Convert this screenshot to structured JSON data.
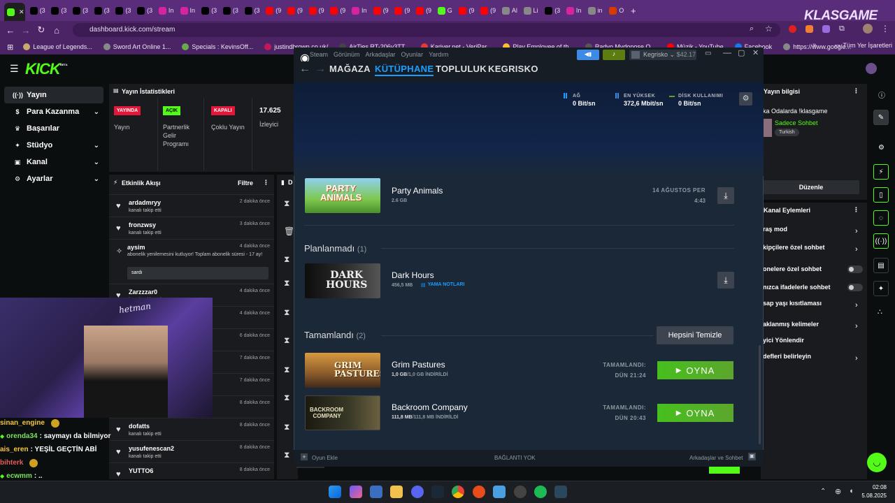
{
  "browser": {
    "tabs": [
      {
        "icon": "kick-icon",
        "label": "",
        "color": "#53fc18"
      },
      {
        "icon": "x-icon",
        "label": "(3",
        "color": "#000000"
      },
      {
        "icon": "x-icon",
        "label": "(3",
        "color": "#000000"
      },
      {
        "icon": "x-icon",
        "label": "(3",
        "color": "#000000"
      },
      {
        "icon": "x-icon",
        "label": "(3",
        "color": "#000000"
      },
      {
        "icon": "x-icon",
        "label": "(3",
        "color": "#000000"
      },
      {
        "icon": "x-icon",
        "label": "(3",
        "color": "#000000"
      },
      {
        "icon": "instagram-icon",
        "label": "In",
        "color": "#d6249f"
      },
      {
        "icon": "instagram-icon",
        "label": "In",
        "color": "#d6249f"
      },
      {
        "icon": "x-icon",
        "label": "(3",
        "color": "#000000"
      },
      {
        "icon": "x-icon",
        "label": "(3",
        "color": "#000000"
      },
      {
        "icon": "x-icon",
        "label": "(3",
        "color": "#000000"
      },
      {
        "icon": "youtube-icon",
        "label": "(9",
        "color": "#ff0000"
      },
      {
        "icon": "youtube-icon",
        "label": "(9",
        "color": "#ff0000"
      },
      {
        "icon": "youtube-icon",
        "label": "(9",
        "color": "#ff0000"
      },
      {
        "icon": "youtube-icon",
        "label": "(9",
        "color": "#ff0000"
      },
      {
        "icon": "instagram-icon",
        "label": "In",
        "color": "#d6249f"
      },
      {
        "icon": "youtube-icon",
        "label": "(9",
        "color": "#ff0000"
      },
      {
        "icon": "youtube-icon",
        "label": "(9",
        "color": "#ff0000"
      },
      {
        "icon": "youtube-icon",
        "label": "(9",
        "color": "#ff0000"
      },
      {
        "icon": "kick-icon",
        "label": "G",
        "color": "#53fc18"
      },
      {
        "icon": "youtube-icon",
        "label": "(9",
        "color": "#ff0000"
      },
      {
        "icon": "youtube-icon",
        "label": "(9",
        "color": "#ff0000"
      },
      {
        "icon": "globe-icon",
        "label": "Al",
        "color": "#888888"
      },
      {
        "icon": "pen-icon",
        "label": "Li",
        "color": "#888888"
      },
      {
        "icon": "x-icon",
        "label": "(3",
        "color": "#000000"
      },
      {
        "icon": "instagram-icon",
        "label": "In",
        "color": "#d6249f"
      },
      {
        "icon": "globe-icon",
        "label": "in",
        "color": "#888888"
      },
      {
        "icon": "mail-icon",
        "label": "O",
        "color": "#d83b01"
      }
    ],
    "brand": "KLASGAME",
    "url": "dashboard.kick.com/stream",
    "bookmarks": [
      {
        "label": "League of Legends...",
        "color": "#c8aa6e"
      },
      {
        "label": "Sword Art Online 1...",
        "color": "#888888"
      },
      {
        "label": "Specials : KevinsOff...",
        "color": "#6aa84f"
      },
      {
        "label": "justindbrown.co.uk/",
        "color": "#c2185b"
      },
      {
        "label": "AirTies RT-206v3TT...",
        "color": "#444444"
      },
      {
        "label": "Kariyer.net - VeriPar...",
        "color": "#e53935"
      },
      {
        "label": "Play Employee of th...",
        "color": "#fbc02d"
      },
      {
        "label": "Radyo Mydonose O...",
        "color": "#555555"
      },
      {
        "label": "Müzik - YouTube",
        "color": "#ff0000"
      },
      {
        "label": "Facebook",
        "color": "#1877f2"
      },
      {
        "label": "https://www.google...",
        "color": "#888888"
      }
    ],
    "all_bookmarks": "Tüm Yer İşaretleri"
  },
  "kick": {
    "logo": "KICK",
    "beta": "BETA",
    "sidebar": [
      {
        "label": "Yayın",
        "selected": true,
        "has_chevron": false
      },
      {
        "label": "Para Kazanma",
        "selected": false,
        "has_chevron": true
      },
      {
        "label": "Başarılar",
        "selected": false,
        "has_chevron": false
      },
      {
        "label": "Stüdyo",
        "selected": false,
        "has_chevron": true
      },
      {
        "label": "Kanal",
        "selected": false,
        "has_chevron": true
      },
      {
        "label": "Ayarlar",
        "selected": false,
        "has_chevron": true
      }
    ],
    "stats": {
      "title": "Yayın İstatistikleri",
      "live_badge": "YAYINDA",
      "live_label": "Yayın",
      "partner_badge": "AÇIK",
      "partner_label": "Partnerlik Gelir Programı",
      "multi_badge": "KAPALI",
      "multi_label": "Çoklu Yayın",
      "viewers": "17.625",
      "viewers_label": "İzleyici"
    },
    "activity": {
      "title": "Etkinlik Akışı",
      "filter": "Filtre",
      "events": [
        {
          "name": "ardadmryy",
          "sub": "kanalı takip etti",
          "time": "2 dakika önce"
        },
        {
          "name": "fronzwsy",
          "sub": "kanalı takip etti",
          "time": "3 dakika önce"
        },
        {
          "name": "aysim",
          "sub": "abonelik yenilemesini kutluyor! Toplam abonelik süresi - 17 ay!",
          "time": "4 dakika önce",
          "msg": "sardı"
        },
        {
          "name": "Zarzzzar0",
          "sub": "kanalı takip etti",
          "time": "4 dakika önce"
        },
        {
          "name": "",
          "sub": "",
          "time": "4 dakika önce"
        },
        {
          "name": "",
          "sub": "",
          "time": "6 dakika önce"
        },
        {
          "name": "",
          "sub": "",
          "time": "7 dakika önce"
        },
        {
          "name": "",
          "sub": "",
          "time": "7 dakika önce"
        },
        {
          "name": "",
          "sub": "",
          "time": "8 dakika önce"
        },
        {
          "name": "dofatts",
          "sub": "kanalı takip etti",
          "time": "8 dakika önce"
        },
        {
          "name": "yusufenescan2",
          "sub": "kanalı takip etti",
          "time": "8 dakika önce"
        },
        {
          "name": "YUTTO6",
          "sub": "",
          "time": "8 dakika önce"
        }
      ]
    },
    "mod_header": "D",
    "chat": [
      {
        "user": "sinan_engine",
        "text": "",
        "color": "#f5c542"
      },
      {
        "user": "orenda34",
        "text": ": saymayı da bilmiyor",
        "color": "#7be060"
      },
      {
        "user": "ais_eren",
        "text": ": YEŞİL GEÇTİN ABİ",
        "color": "#f5c542"
      },
      {
        "user": "bihterk",
        "text": "",
        "color": "#e85a5a"
      },
      {
        "user": "ecwmm",
        "text": ": ..",
        "color": "#7be060"
      }
    ],
    "webcam_sign": "hetman",
    "stream_info": {
      "title": "Yayın bilgisi",
      "stream_title": "ka Odalarda !klasgame",
      "category": "Sadece Sohbet",
      "language": "Turkish",
      "edit": "Düzenle"
    },
    "channel_actions": {
      "title": "Kanal Eylemleri",
      "items": [
        {
          "label": "raş mod",
          "type": "chevron"
        },
        {
          "label": "kipçilere özel sohbet",
          "type": "chevron"
        },
        {
          "label": "onelere özel sohbet",
          "type": "toggle"
        },
        {
          "label": "nızca ifadelerle sohbet",
          "type": "toggle"
        },
        {
          "label": "sap yaşı kısıtlaması",
          "type": "chevron"
        },
        {
          "label": "aklanmış kelimeler",
          "type": "chevron"
        },
        {
          "label": "yici Yönlendir",
          "type": "none"
        },
        {
          "label": "defleri belirleyin",
          "type": "chevron"
        }
      ]
    }
  },
  "steam": {
    "menu": [
      "Steam",
      "Görünüm",
      "Arkadaşlar",
      "Oyunlar",
      "Yardım"
    ],
    "user": "Kegrisko",
    "balance": "$42.17",
    "nav": [
      "MAĞAZA",
      "KÜTÜPHANE",
      "TOPLULUK",
      "KEGRISKO"
    ],
    "active_nav": "KÜTÜPHANE",
    "network": {
      "label": "AĞ",
      "value": "0 Bit/sn"
    },
    "peak": {
      "label": "EN YÜKSEK",
      "value": "372,6 Mbit/sn"
    },
    "disk": {
      "label": "DİSK KULLANIMI",
      "value": "0 Bit/sn"
    },
    "queued": {
      "title": "Party Animals",
      "size": "2.6 GB",
      "date": "14 AĞUSTOS PER",
      "time": "4:43"
    },
    "unscheduled": {
      "header": "Planlanmadı",
      "count": "(1)",
      "title": "Dark Hours",
      "size": "456,5 MB",
      "notes": "YAMA NOTLARI"
    },
    "completed": {
      "header": "Tamamlandı",
      "count": "(2)",
      "clear": "Hepsini Temizle",
      "items": [
        {
          "title": "Grim Pastures",
          "size_done": "1,0 GB",
          "size_total": "/1,0 GB İNDİRİLDİ",
          "done_label": "TAMAMLANDI:",
          "done_time": "DÜN 21:24",
          "play": "OYNA"
        },
        {
          "title": "Backroom Company",
          "size_done": "111,8 MB",
          "size_total": "/111,8 MB İNDİRİLDİ",
          "done_label": "TAMAMLANDI:",
          "done_time": "DÜN 20:43",
          "play": "OYNA"
        }
      ]
    },
    "footer": {
      "add_game": "Oyun Ekle",
      "status": "BAĞLANTI YOK",
      "friends": "Arkadaşlar ve Sohbet"
    }
  },
  "taskbar": {
    "time": "02:08",
    "date": "5.08.2025"
  }
}
